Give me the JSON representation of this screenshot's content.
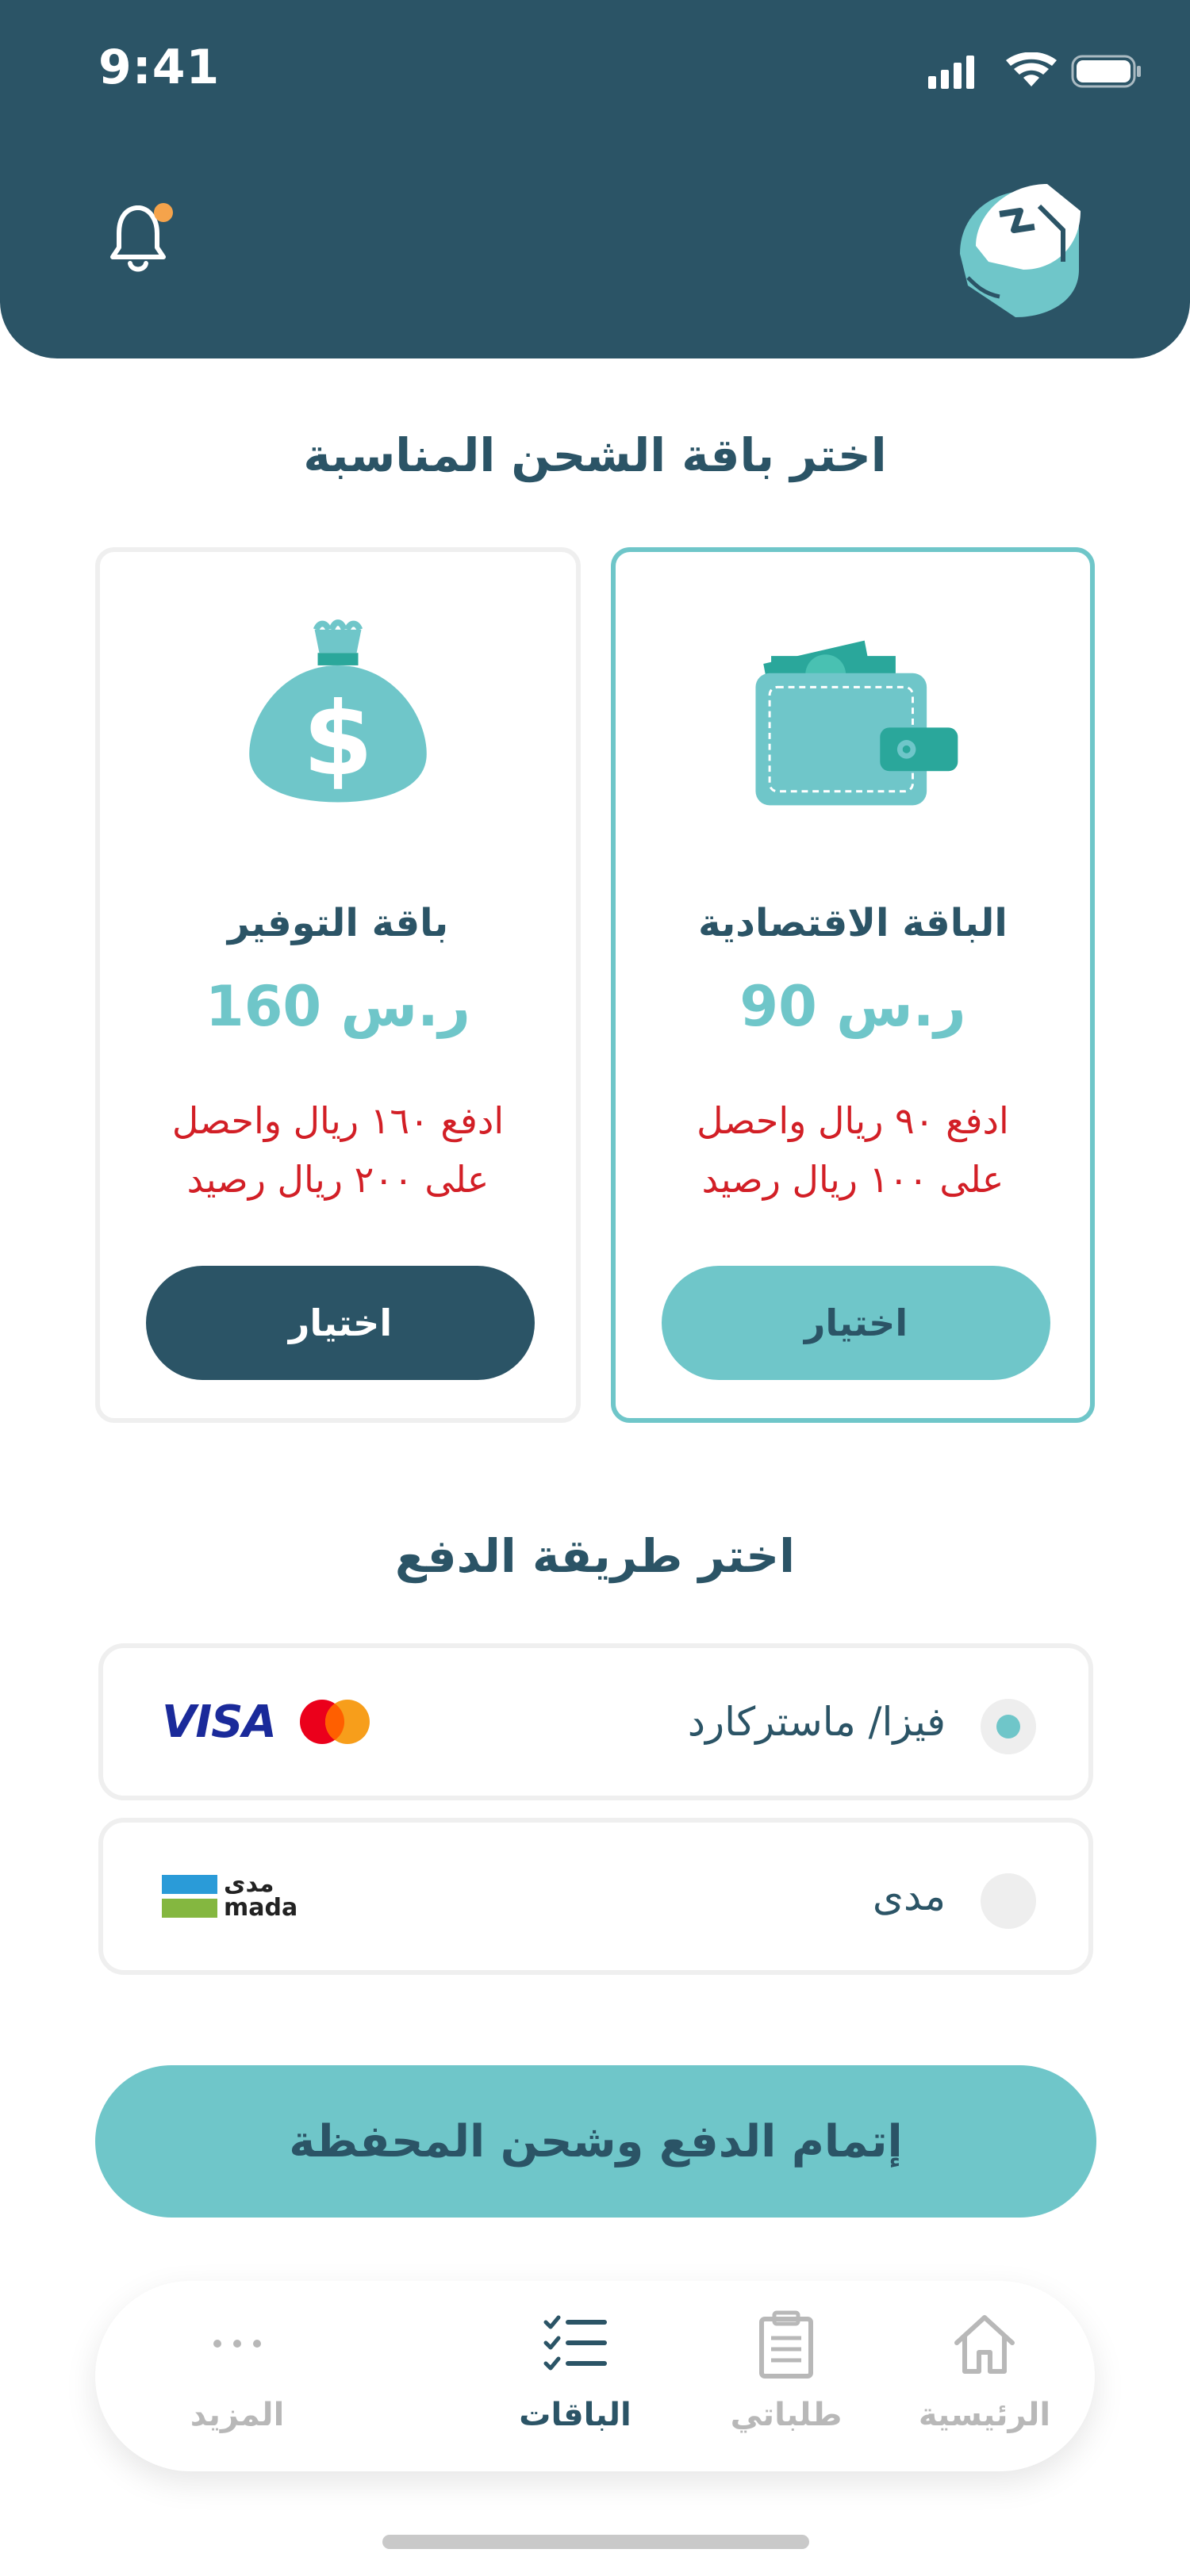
{
  "status_bar": {
    "time": "9:41"
  },
  "section_packages": {
    "title": "اختر باقة الشحن المناسبة"
  },
  "packages": [
    {
      "name": "الباقة الاقتصادية",
      "price": "90 ر.س",
      "desc_line1": "ادفع ٩٠ ريال واحصل",
      "desc_line2": "على ١٠٠ ريال رصيد",
      "button": "اختيار",
      "selected": true
    },
    {
      "name": "باقة التوفير",
      "price": "160 ر.س",
      "desc_line1": "ادفع ١٦٠ ريال واحصل",
      "desc_line2": "على ٢٠٠ ريال رصيد",
      "button": "اختيار",
      "selected": false
    }
  ],
  "section_payment": {
    "title": "اختر طريقة الدفع"
  },
  "payment_methods": [
    {
      "label": "فيزا/ ماستركارد",
      "logo_text": "VISA",
      "selected": true
    },
    {
      "label": "مدى",
      "logo_text_ar": "مدى",
      "logo_text_en": "mada",
      "selected": false
    }
  ],
  "cta": {
    "label": "إتمام الدفع وشحن المحفظة"
  },
  "bottom_nav": [
    {
      "label": "الرئيسية",
      "icon": "home-icon",
      "active": false
    },
    {
      "label": "طلباتي",
      "icon": "orders-clipboard-icon",
      "active": false
    },
    {
      "label": "الباقات",
      "icon": "packages-checklist-icon",
      "active": true
    },
    {
      "label": "المزيد",
      "icon": "more-dots-icon",
      "active": false
    }
  ],
  "colors": {
    "primary_dark": "#2b5466",
    "accent_teal": "#6fc6c9",
    "alert_red": "#d21f26",
    "notification_dot": "#f5a34b"
  }
}
